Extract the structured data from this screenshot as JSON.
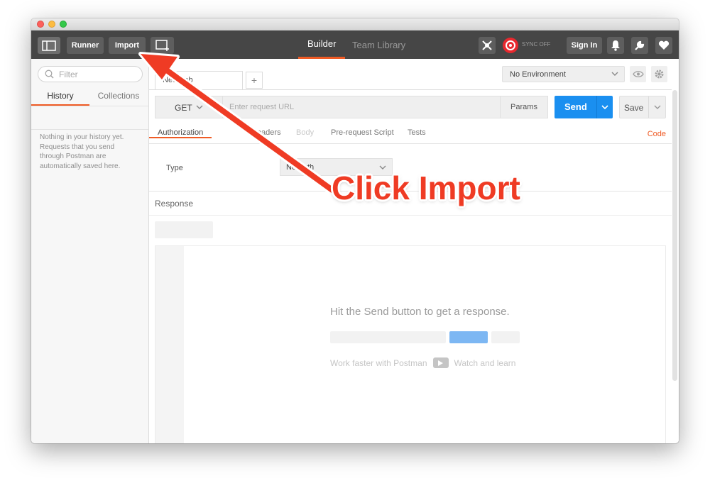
{
  "toolbar": {
    "runner_label": "Runner",
    "import_label": "Import",
    "tabs": [
      {
        "label": "Builder"
      },
      {
        "label": "Team Library"
      }
    ],
    "sync_label": "SYNC OFF",
    "signin_label": "Sign In"
  },
  "sidebar": {
    "filter_placeholder": "Filter",
    "tabs": [
      {
        "label": "History"
      },
      {
        "label": "Collections"
      }
    ],
    "empty_text": "Nothing in your history yet. Requests that you send through Postman are automatically saved here."
  },
  "request": {
    "tab_label": "New Tab",
    "add_tab": "+",
    "environment": "No Environment",
    "method": "GET",
    "url_placeholder": "Enter request URL",
    "params_label": "Params",
    "send_label": "Send",
    "save_label": "Save",
    "tabs": [
      {
        "label": "Authorization"
      },
      {
        "label": "Headers"
      },
      {
        "label": "Body"
      },
      {
        "label": "Pre-request Script"
      },
      {
        "label": "Tests"
      }
    ],
    "code_label": "Code",
    "auth_type_label": "Type",
    "auth_type_value": "No Auth"
  },
  "response": {
    "label": "Response",
    "hint": "Hit the Send button to get a response.",
    "learn_left": "Work faster with Postman",
    "learn_right": "Watch and learn"
  },
  "annotation": {
    "callout": "Click Import"
  },
  "colors": {
    "accent": "#ef5b25",
    "send": "#1a8ff0",
    "toolbar": "#464646",
    "callout": "#ef3b24"
  },
  "icons": [
    "sidebar-toggle-icon",
    "new-window-icon",
    "interceptor-icon",
    "sync-icon",
    "bell-icon",
    "wrench-icon",
    "heart-icon",
    "search-icon",
    "chevron-down-icon",
    "eye-icon",
    "gear-icon",
    "play-icon",
    "arrow-icon"
  ]
}
